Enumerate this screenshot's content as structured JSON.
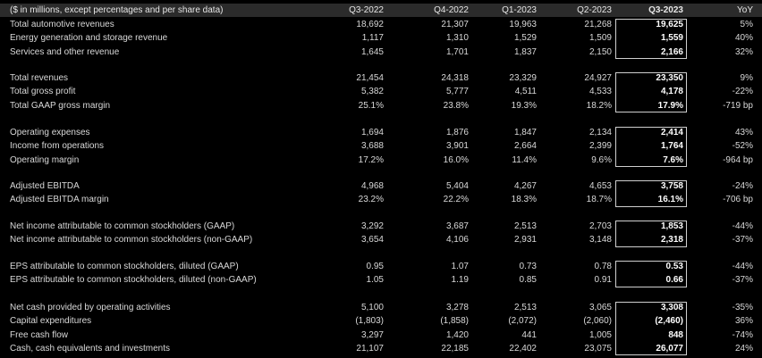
{
  "header": {
    "label": "($ in millions, except percentages and per share data)",
    "periods": [
      "Q3-2022",
      "Q4-2022",
      "Q1-2023",
      "Q2-2023",
      "Q3-2023",
      "YoY"
    ]
  },
  "groups": [
    {
      "rows": [
        {
          "label": "Total automotive revenues",
          "values": [
            "18,692",
            "21,307",
            "19,963",
            "21,268",
            "19,625",
            "5%"
          ]
        },
        {
          "label": "Energy generation and storage revenue",
          "values": [
            "1,117",
            "1,310",
            "1,529",
            "1,509",
            "1,559",
            "40%"
          ]
        },
        {
          "label": "Services and other revenue",
          "values": [
            "1,645",
            "1,701",
            "1,837",
            "2,150",
            "2,166",
            "32%"
          ]
        }
      ]
    },
    {
      "rows": [
        {
          "label": "Total revenues",
          "values": [
            "21,454",
            "24,318",
            "23,329",
            "24,927",
            "23,350",
            "9%"
          ]
        },
        {
          "label": "Total gross profit",
          "values": [
            "5,382",
            "5,777",
            "4,511",
            "4,533",
            "4,178",
            "-22%"
          ]
        },
        {
          "label": "Total GAAP gross margin",
          "values": [
            "25.1%",
            "23.8%",
            "19.3%",
            "18.2%",
            "17.9%",
            "-719 bp"
          ]
        }
      ]
    },
    {
      "rows": [
        {
          "label": "Operating expenses",
          "values": [
            "1,694",
            "1,876",
            "1,847",
            "2,134",
            "2,414",
            "43%"
          ]
        },
        {
          "label": "Income from operations",
          "values": [
            "3,688",
            "3,901",
            "2,664",
            "2,399",
            "1,764",
            "-52%"
          ]
        },
        {
          "label": "Operating margin",
          "values": [
            "17.2%",
            "16.0%",
            "11.4%",
            "9.6%",
            "7.6%",
            "-964 bp"
          ]
        }
      ]
    },
    {
      "rows": [
        {
          "label": "Adjusted EBITDA",
          "values": [
            "4,968",
            "5,404",
            "4,267",
            "4,653",
            "3,758",
            "-24%"
          ]
        },
        {
          "label": "Adjusted EBITDA margin",
          "values": [
            "23.2%",
            "22.2%",
            "18.3%",
            "18.7%",
            "16.1%",
            "-706 bp"
          ]
        }
      ]
    },
    {
      "rows": [
        {
          "label": "Net income attributable to common stockholders (GAAP)",
          "values": [
            "3,292",
            "3,687",
            "2,513",
            "2,703",
            "1,853",
            "-44%"
          ]
        },
        {
          "label": "Net income attributable to common stockholders (non-GAAP)",
          "values": [
            "3,654",
            "4,106",
            "2,931",
            "3,148",
            "2,318",
            "-37%"
          ]
        }
      ]
    },
    {
      "rows": [
        {
          "label": "EPS attributable to common stockholders, diluted (GAAP)",
          "values": [
            "0.95",
            "1.07",
            "0.73",
            "0.78",
            "0.53",
            "-44%"
          ]
        },
        {
          "label": "EPS attributable to common stockholders, diluted (non-GAAP)",
          "values": [
            "1.05",
            "1.19",
            "0.85",
            "0.91",
            "0.66",
            "-37%"
          ]
        }
      ]
    },
    {
      "rows": [
        {
          "label": "Net cash provided by operating activities",
          "values": [
            "5,100",
            "3,278",
            "2,513",
            "3,065",
            "3,308",
            "-35%"
          ]
        },
        {
          "label": "Capital expenditures",
          "values": [
            "(1,803)",
            "(1,858)",
            "(2,072)",
            "(2,060)",
            "(2,460)",
            "36%"
          ]
        },
        {
          "label": "Free cash flow",
          "values": [
            "3,297",
            "1,420",
            "441",
            "1,005",
            "848",
            "-74%"
          ]
        },
        {
          "label": "Cash, cash equivalents and investments",
          "values": [
            "21,107",
            "22,185",
            "22,402",
            "23,075",
            "26,077",
            "24%"
          ]
        }
      ]
    }
  ]
}
